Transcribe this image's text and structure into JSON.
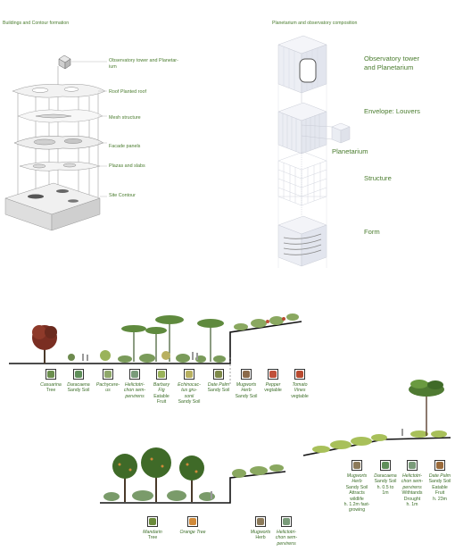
{
  "titles": {
    "left": "Buildings and Contour formation",
    "right": "Planetarium and observatory composition"
  },
  "left_labels": [
    "Observatory tower and Planetar-\nium",
    "Roof Planted roof",
    "Mesh structure",
    "Facade panels",
    "Plazas and slabs",
    "Site Contour"
  ],
  "right_labels": [
    "Observatory tower\nand Planetarium",
    "Envelope: Louvers",
    "Planetarium",
    "Structure",
    "Form"
  ],
  "section1_plants": [
    {
      "name": "Casuarina",
      "detail": "Tree",
      "color": "#6b8e4e"
    },
    {
      "name": "Daracaena",
      "detail": "Sandy Soil",
      "color": "#5f8f5a"
    },
    {
      "name": "Pachycere-\nus",
      "detail": "",
      "color": "#8fa86a"
    },
    {
      "name": "Helictotri-\nchon sem-\npervirens",
      "detail": "",
      "color": "#7a9b7a"
    },
    {
      "name": "Barbary\nFig",
      "detail": "Eatable\nFruit",
      "color": "#9ab35a"
    },
    {
      "name": "Echinocac-\ntus gru-\nsonii",
      "detail": "Sandy Soil",
      "color": "#b8b060"
    },
    {
      "name": "Date Palm",
      "detail": "Sandy Soil",
      "color": "#7f8a4a"
    },
    {
      "name": "Mugworts\nHerb",
      "detail": "Sandy Soil",
      "color": "#8c6a4a"
    },
    {
      "name": "Pepper",
      "detail": "vegtable",
      "color": "#c0503a"
    },
    {
      "name": "Tomato\nVines",
      "detail": "vegtable",
      "color": "#b84a30"
    }
  ],
  "section2_plants_right": [
    {
      "name": "Mugworts\nHerb",
      "detail": "Sandy Soil\nAttracts\nwildlife\nh. 1.2m fast-\ngrowing",
      "color": "#8c7a5a"
    },
    {
      "name": "Daracaena",
      "detail": "Sandy Soil\nh. 0.5 to\n1m",
      "color": "#5f8f5a"
    },
    {
      "name": "Helictotri-\nchon sem-\npervirens",
      "detail": "Withtands\nDrought\nh. 1m",
      "color": "#7a9b7a"
    },
    {
      "name": "Date Palm",
      "detail": "Sandy Soil\nEatable\nFruit\nh. 23m",
      "color": "#9a6a3a"
    }
  ],
  "section3_plants": [
    {
      "name": "Mandarin",
      "detail": "Tree",
      "color": "#6a8a3a"
    },
    {
      "name": "Orange Tree",
      "detail": "",
      "color": "#d08a3a"
    },
    {
      "name": "Mugworts",
      "detail": "Herb",
      "color": "#8c7a5a"
    },
    {
      "name": "Helictotri-\nchon sem-\npervirens",
      "detail": "",
      "color": "#7a9b7a"
    }
  ]
}
